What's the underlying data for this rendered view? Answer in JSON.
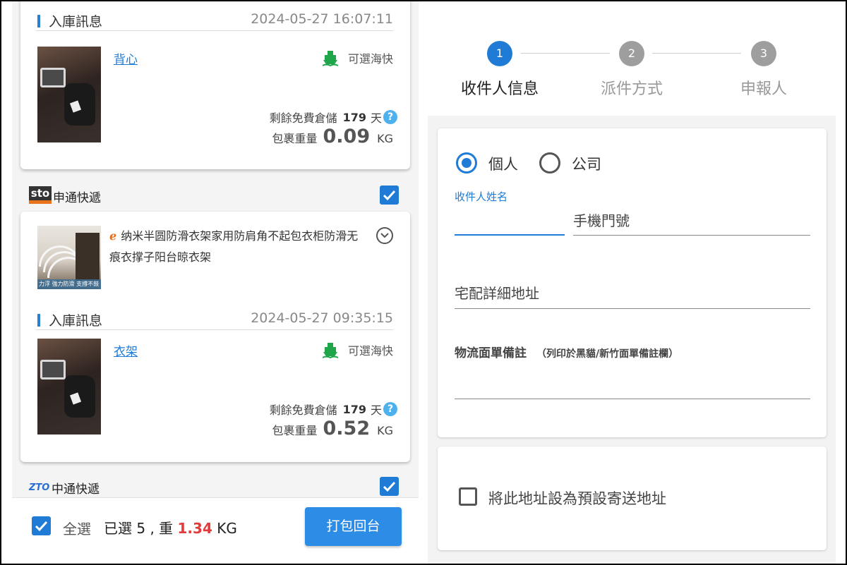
{
  "left": {
    "cards": [
      {
        "inbound_label": "入庫訊息",
        "inbound_time": "2024-05-27 16:07:11",
        "item_name": "背心",
        "shipping_option": "可選海快",
        "storage_label": "剩餘免費倉儲",
        "storage_days": "179",
        "storage_unit": "天",
        "weight_label": "包裹重量",
        "weight_value": "0.09",
        "weight_unit": "KG"
      },
      {
        "product_title": "纳米半圆防滑衣架家用防肩角不起包衣柜防滑无痕衣撑子阳台晾衣架",
        "inbound_label": "入庫訊息",
        "inbound_time": "2024-05-27 09:35:15",
        "item_name": "衣架",
        "shipping_option": "可選海快",
        "storage_label": "剩餘免費倉儲",
        "storage_days": "179",
        "storage_unit": "天",
        "weight_label": "包裹重量",
        "weight_value": "0.52",
        "weight_unit": "KG"
      }
    ],
    "carriers": [
      {
        "logo_text": "sto",
        "name": "申通快遞",
        "checked": true
      },
      {
        "logo_text": "ZTO",
        "name": "中通快遞",
        "checked": true
      }
    ],
    "product_thumb_label": "力浮 強力防滑 支撐不鼓包",
    "bottom_bar": {
      "select_all_label": "全選",
      "selected_prefix": "已選 5 , 重 ",
      "selected_weight": "1.34",
      "selected_unit": " KG",
      "pack_button": "打包回台"
    }
  },
  "right": {
    "steps": [
      {
        "number": "1",
        "label": "收件人信息",
        "active": true
      },
      {
        "number": "2",
        "label": "派件方式",
        "active": false
      },
      {
        "number": "3",
        "label": "申報人",
        "active": false
      }
    ],
    "recipient_type": {
      "options": [
        "個人",
        "公司"
      ],
      "selected": "個人"
    },
    "form": {
      "name_label": "收件人姓名",
      "phone_placeholder": "手機門號",
      "address_placeholder": "宅配詳細地址",
      "remark_label": "物流面單備註",
      "remark_hint": "（列印於黑貓/新竹面單備註欄）"
    },
    "default_address_label": "將此地址設為預設寄送地址"
  },
  "colors": {
    "accent": "#1f7bd6",
    "button": "#2d8de6",
    "weight_highlight": "#e23b3b",
    "step_inactive": "#9e9e9e",
    "ship_icon": "#1fa64a"
  },
  "icons": [
    "ship-icon",
    "help-icon",
    "check-icon",
    "chevron-down-icon",
    "aliexpress-icon",
    "sto-logo",
    "zto-logo"
  ]
}
